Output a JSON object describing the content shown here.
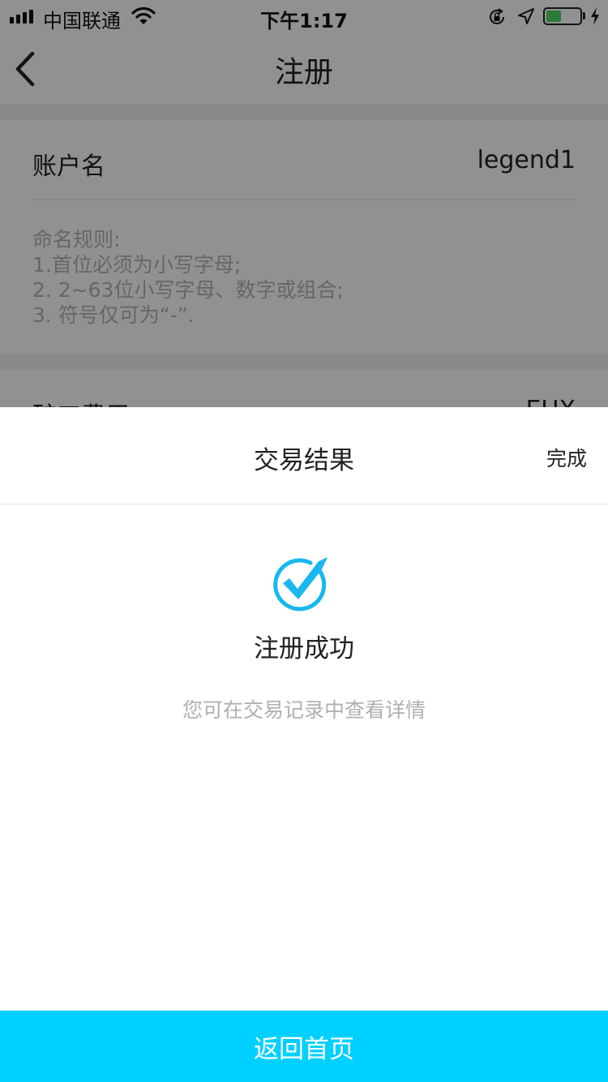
{
  "status_bar": {
    "carrier": "中国联通",
    "time": "下午1:17",
    "battery_level": 0.45,
    "icons": [
      "signal-icon",
      "wifi-icon",
      "orientation-lock-icon",
      "location-icon",
      "battery-icon",
      "charging-icon"
    ]
  },
  "nav": {
    "title": "注册",
    "back_icon": "chevron-left-icon"
  },
  "form": {
    "account_label": "账户名",
    "account_value": "legend1",
    "rules": [
      "命名规则:",
      "1.首位必须为小写字母;",
      "2. 2~63位小写字母、数字或组合;",
      "3. 符号仅可为“-”."
    ],
    "fee_label": "矿工费用",
    "fee_value": "EUX"
  },
  "sheet": {
    "title": "交易结果",
    "done_label": "完成",
    "result_icon": "check-circle-icon",
    "result_title": "注册成功",
    "result_subtitle": "您可在交易记录中查看详情",
    "home_button_label": "返回首页"
  },
  "colors": {
    "accent": "#00d0ff",
    "check_icon": "#18b8ee",
    "overlay": "rgba(0,0,0,0.43)",
    "battery_fill": "#4cd964"
  }
}
